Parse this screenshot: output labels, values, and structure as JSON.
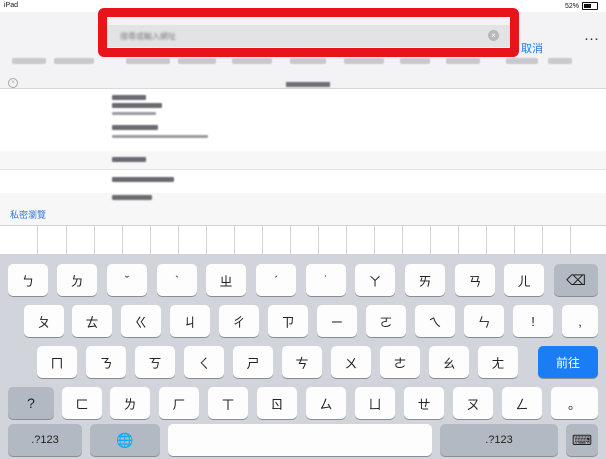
{
  "status": {
    "device": "iPad",
    "battery": "52%"
  },
  "browser": {
    "url_text": "搜尋或輸入網址",
    "cancel_label": "取消",
    "more_label": "···",
    "tab_close_label": "×"
  },
  "suggestions": {
    "private_label": "私密瀏覽"
  },
  "keyboard": {
    "row1": [
      "ㄅ",
      "ㄉ",
      "ˇ",
      "ˋ",
      "ㄓ",
      "ˊ",
      "˙",
      "ㄚ",
      "ㄞ",
      "ㄢ",
      "ㄦ",
      "⌫"
    ],
    "row2": [
      "ㄆ",
      "ㄊ",
      "ㄍ",
      "ㄐ",
      "ㄔ",
      "ㄗ",
      "ㄧ",
      "ㄛ",
      "ㄟ",
      "ㄣ",
      "!",
      ","
    ],
    "row3": [
      "ㄇ",
      "ㄋ",
      "ㄎ",
      "ㄑ",
      "ㄕ",
      "ㄘ",
      "ㄨ",
      "ㄜ",
      "ㄠ",
      "ㄤ",
      "前往"
    ],
    "row4": [
      "?",
      "ㄈ",
      "ㄌ",
      "ㄏ",
      "ㄒ",
      "ㄖ",
      "ㄙ",
      "ㄩ",
      "ㄝ",
      "ㄡ",
      "ㄥ",
      "。"
    ],
    "row5": [
      ".?123",
      "🌐",
      "",
      ".?123",
      "⌨"
    ]
  },
  "colors": {
    "accent": "#1a7df5",
    "highlight": "#e8141c"
  }
}
